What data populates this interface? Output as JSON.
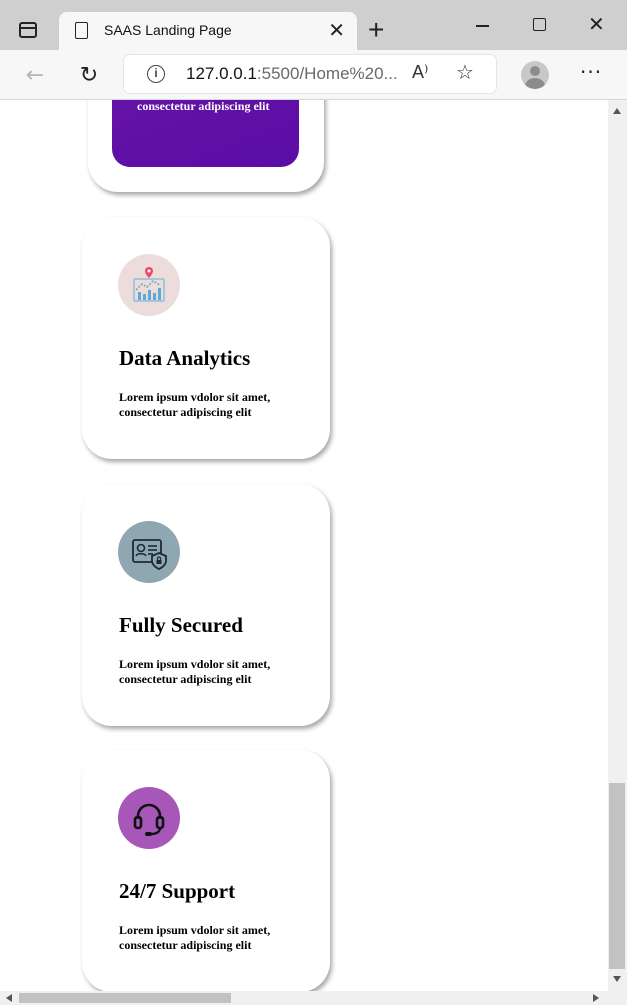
{
  "browser": {
    "tab_title": "SAAS Landing Page",
    "url_host": "127.0.0.1",
    "url_rest": ":5500/Home%20...",
    "icons": {
      "sidebar": "tab-actions-icon",
      "page": "document-icon",
      "close": "close-icon",
      "new_tab": "plus-icon",
      "back": "back-arrow-icon",
      "reload": "reload-icon",
      "info": "info-icon",
      "read_aloud": "read-aloud-icon",
      "favorites": "add-favorite-icon",
      "profile": "profile-avatar",
      "more": "more-icon"
    },
    "glyphs": {
      "close": "✕",
      "new_tab": "+",
      "back": "←",
      "reload": "↻",
      "info": "i",
      "read_aloud": "A⁾",
      "favorites": "☆",
      "more": "···",
      "win_close": "✕"
    }
  },
  "page": {
    "partial_card": {
      "text": "consectetur adipiscing elit",
      "color": "#5f10a7"
    },
    "cards": [
      {
        "title": "Data Analytics",
        "text": "Lorem ipsum vdolor sit amet, consectetur adipiscing elit",
        "icon": "data-analytics-icon",
        "icon_bg": "#eddcdc"
      },
      {
        "title": "Fully Secured",
        "text": "Lorem ipsum vdolor sit amet, consectetur adipiscing elit",
        "icon": "secure-document-icon",
        "icon_bg": "#8ea7b0"
      },
      {
        "title": "24/7 Support",
        "text": "Lorem ipsum vdolor sit amet, consectetur adipiscing elit",
        "icon": "headset-icon",
        "icon_bg": "#a757b8"
      }
    ]
  }
}
